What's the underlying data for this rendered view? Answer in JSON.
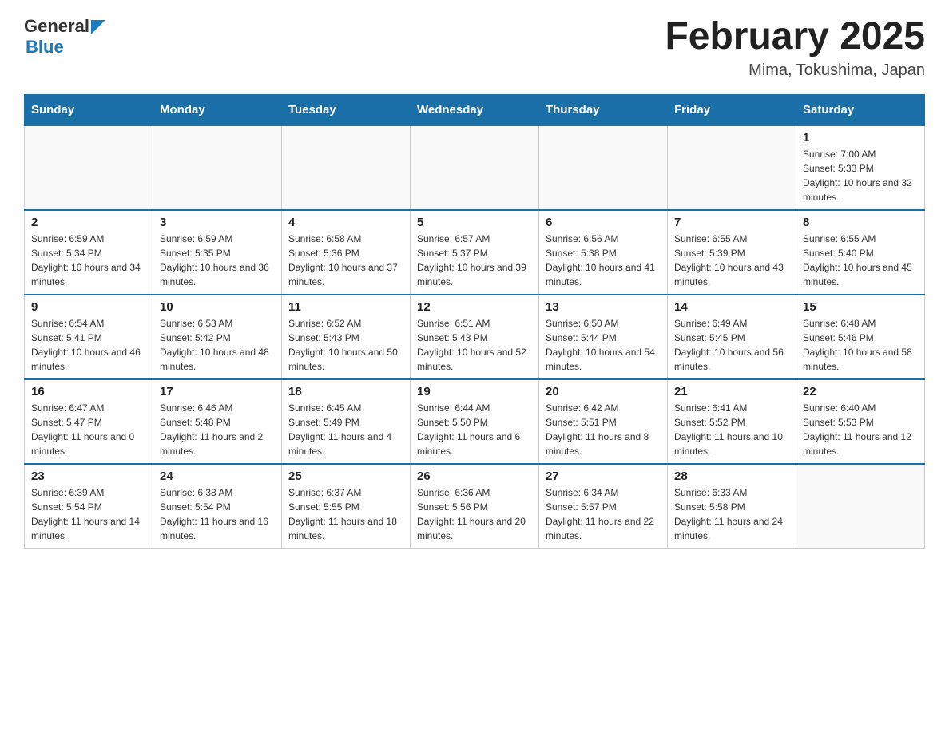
{
  "header": {
    "logo_general": "General",
    "logo_blue": "Blue",
    "title": "February 2025",
    "location": "Mima, Tokushima, Japan"
  },
  "days_of_week": [
    "Sunday",
    "Monday",
    "Tuesday",
    "Wednesday",
    "Thursday",
    "Friday",
    "Saturday"
  ],
  "weeks": [
    [
      {
        "day": "",
        "info": ""
      },
      {
        "day": "",
        "info": ""
      },
      {
        "day": "",
        "info": ""
      },
      {
        "day": "",
        "info": ""
      },
      {
        "day": "",
        "info": ""
      },
      {
        "day": "",
        "info": ""
      },
      {
        "day": "1",
        "info": "Sunrise: 7:00 AM\nSunset: 5:33 PM\nDaylight: 10 hours and 32 minutes."
      }
    ],
    [
      {
        "day": "2",
        "info": "Sunrise: 6:59 AM\nSunset: 5:34 PM\nDaylight: 10 hours and 34 minutes."
      },
      {
        "day": "3",
        "info": "Sunrise: 6:59 AM\nSunset: 5:35 PM\nDaylight: 10 hours and 36 minutes."
      },
      {
        "day": "4",
        "info": "Sunrise: 6:58 AM\nSunset: 5:36 PM\nDaylight: 10 hours and 37 minutes."
      },
      {
        "day": "5",
        "info": "Sunrise: 6:57 AM\nSunset: 5:37 PM\nDaylight: 10 hours and 39 minutes."
      },
      {
        "day": "6",
        "info": "Sunrise: 6:56 AM\nSunset: 5:38 PM\nDaylight: 10 hours and 41 minutes."
      },
      {
        "day": "7",
        "info": "Sunrise: 6:55 AM\nSunset: 5:39 PM\nDaylight: 10 hours and 43 minutes."
      },
      {
        "day": "8",
        "info": "Sunrise: 6:55 AM\nSunset: 5:40 PM\nDaylight: 10 hours and 45 minutes."
      }
    ],
    [
      {
        "day": "9",
        "info": "Sunrise: 6:54 AM\nSunset: 5:41 PM\nDaylight: 10 hours and 46 minutes."
      },
      {
        "day": "10",
        "info": "Sunrise: 6:53 AM\nSunset: 5:42 PM\nDaylight: 10 hours and 48 minutes."
      },
      {
        "day": "11",
        "info": "Sunrise: 6:52 AM\nSunset: 5:43 PM\nDaylight: 10 hours and 50 minutes."
      },
      {
        "day": "12",
        "info": "Sunrise: 6:51 AM\nSunset: 5:43 PM\nDaylight: 10 hours and 52 minutes."
      },
      {
        "day": "13",
        "info": "Sunrise: 6:50 AM\nSunset: 5:44 PM\nDaylight: 10 hours and 54 minutes."
      },
      {
        "day": "14",
        "info": "Sunrise: 6:49 AM\nSunset: 5:45 PM\nDaylight: 10 hours and 56 minutes."
      },
      {
        "day": "15",
        "info": "Sunrise: 6:48 AM\nSunset: 5:46 PM\nDaylight: 10 hours and 58 minutes."
      }
    ],
    [
      {
        "day": "16",
        "info": "Sunrise: 6:47 AM\nSunset: 5:47 PM\nDaylight: 11 hours and 0 minutes."
      },
      {
        "day": "17",
        "info": "Sunrise: 6:46 AM\nSunset: 5:48 PM\nDaylight: 11 hours and 2 minutes."
      },
      {
        "day": "18",
        "info": "Sunrise: 6:45 AM\nSunset: 5:49 PM\nDaylight: 11 hours and 4 minutes."
      },
      {
        "day": "19",
        "info": "Sunrise: 6:44 AM\nSunset: 5:50 PM\nDaylight: 11 hours and 6 minutes."
      },
      {
        "day": "20",
        "info": "Sunrise: 6:42 AM\nSunset: 5:51 PM\nDaylight: 11 hours and 8 minutes."
      },
      {
        "day": "21",
        "info": "Sunrise: 6:41 AM\nSunset: 5:52 PM\nDaylight: 11 hours and 10 minutes."
      },
      {
        "day": "22",
        "info": "Sunrise: 6:40 AM\nSunset: 5:53 PM\nDaylight: 11 hours and 12 minutes."
      }
    ],
    [
      {
        "day": "23",
        "info": "Sunrise: 6:39 AM\nSunset: 5:54 PM\nDaylight: 11 hours and 14 minutes."
      },
      {
        "day": "24",
        "info": "Sunrise: 6:38 AM\nSunset: 5:54 PM\nDaylight: 11 hours and 16 minutes."
      },
      {
        "day": "25",
        "info": "Sunrise: 6:37 AM\nSunset: 5:55 PM\nDaylight: 11 hours and 18 minutes."
      },
      {
        "day": "26",
        "info": "Sunrise: 6:36 AM\nSunset: 5:56 PM\nDaylight: 11 hours and 20 minutes."
      },
      {
        "day": "27",
        "info": "Sunrise: 6:34 AM\nSunset: 5:57 PM\nDaylight: 11 hours and 22 minutes."
      },
      {
        "day": "28",
        "info": "Sunrise: 6:33 AM\nSunset: 5:58 PM\nDaylight: 11 hours and 24 minutes."
      },
      {
        "day": "",
        "info": ""
      }
    ]
  ],
  "colors": {
    "header_bg": "#1a6fa8",
    "header_text": "#ffffff",
    "border_top": "#1a6fa8"
  }
}
